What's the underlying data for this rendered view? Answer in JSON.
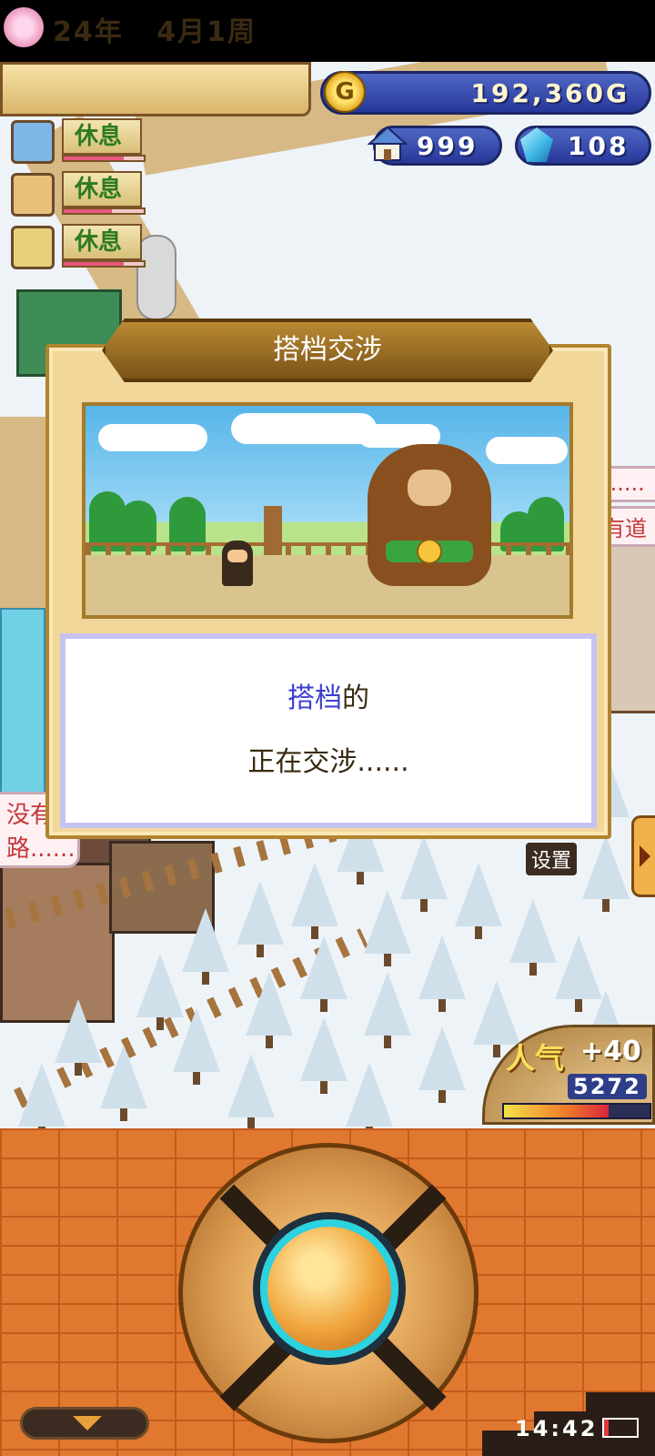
{
  "date": {
    "year": "24年",
    "month_week": "4月1周"
  },
  "resources": {
    "gold": "192,360G",
    "houses": "999",
    "gems": "108"
  },
  "staff": [
    {
      "status": "休息",
      "stamina": 0.75
    },
    {
      "status": "休息",
      "stamina": 0.6
    },
    {
      "status": "休息",
      "stamina": 0.75
    }
  ],
  "dialog": {
    "title": "搭档交涉",
    "message_highlight": "搭档",
    "message_line1_suffix": "的",
    "message_line2": "正在交涉......"
  },
  "side_hints": {
    "right_top": "......",
    "right_mid": "有道",
    "left_line1": "没有",
    "left_line2": "路......",
    "settings": "设置"
  },
  "popularity": {
    "label": "人气",
    "bonus": "+40",
    "value": "5272",
    "fill": 0.72
  },
  "status_bar": {
    "time": "14:42",
    "battery_level": 0.14
  },
  "colors": {
    "accent_blue": "#3c3fcf",
    "brick": "#e0782f",
    "panel_blue": "#27379a"
  }
}
